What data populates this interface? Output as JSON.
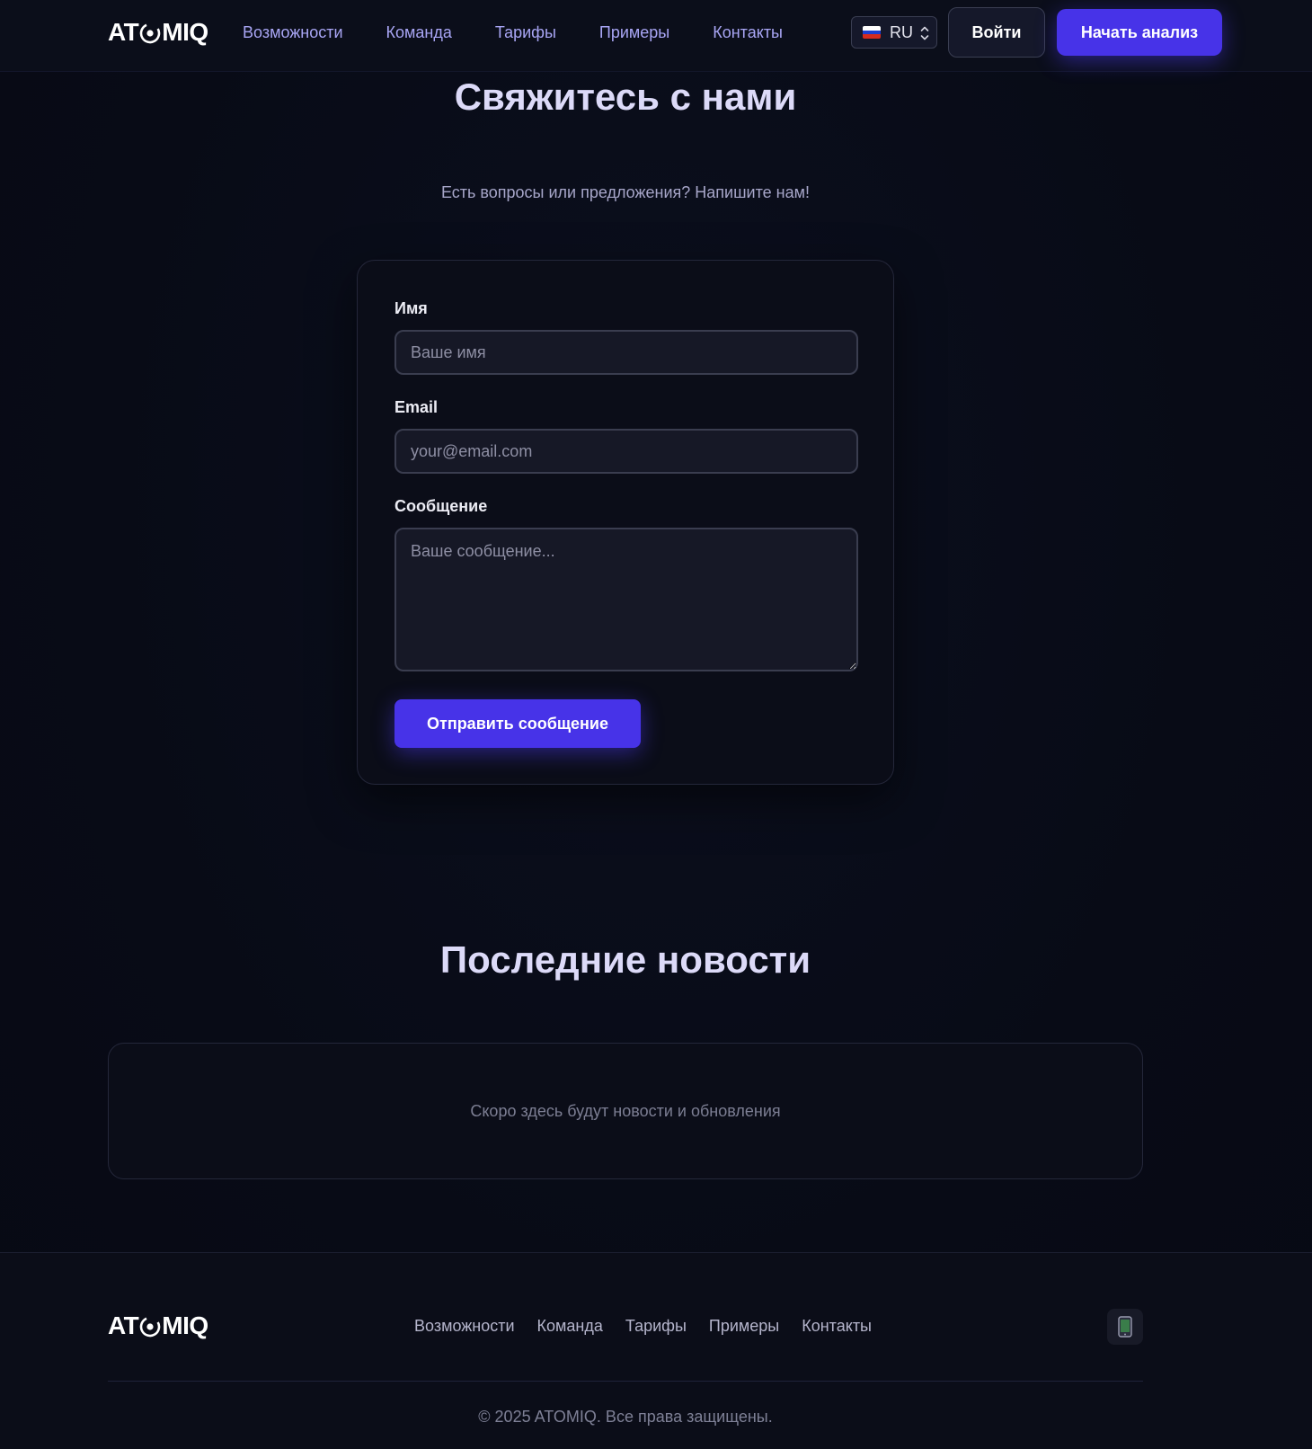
{
  "brand": {
    "name_left": "AT",
    "name_right": "MIQ",
    "colors": {
      "accent": "#4733e8",
      "background": "#080b16",
      "nav_link": "#a9a6f5"
    }
  },
  "header": {
    "nav": [
      "Возможности",
      "Команда",
      "Тарифы",
      "Примеры",
      "Контакты"
    ],
    "language": {
      "selected": "RU",
      "flag_icon": "russia-flag-icon"
    },
    "login_label": "Войти",
    "start_label": "Начать анализ"
  },
  "contact": {
    "title": "Свяжитесь с нами",
    "subtitle": "Есть вопросы или предложения? Напишите нам!",
    "form": {
      "name_label": "Имя",
      "name_placeholder": "Ваше имя",
      "email_label": "Email",
      "email_placeholder": "your@email.com",
      "message_label": "Сообщение",
      "message_placeholder": "Ваше сообщение...",
      "submit_label": "Отправить сообщение"
    }
  },
  "news": {
    "title": "Последние новости",
    "empty_text": "Скоро здесь будут новости и обновления"
  },
  "footer": {
    "nav": [
      "Возможности",
      "Команда",
      "Тарифы",
      "Примеры",
      "Контакты"
    ],
    "mobile_icon": "mobile-phone-icon",
    "copyright": "© 2025 ATOMIQ. Все права защищены."
  }
}
